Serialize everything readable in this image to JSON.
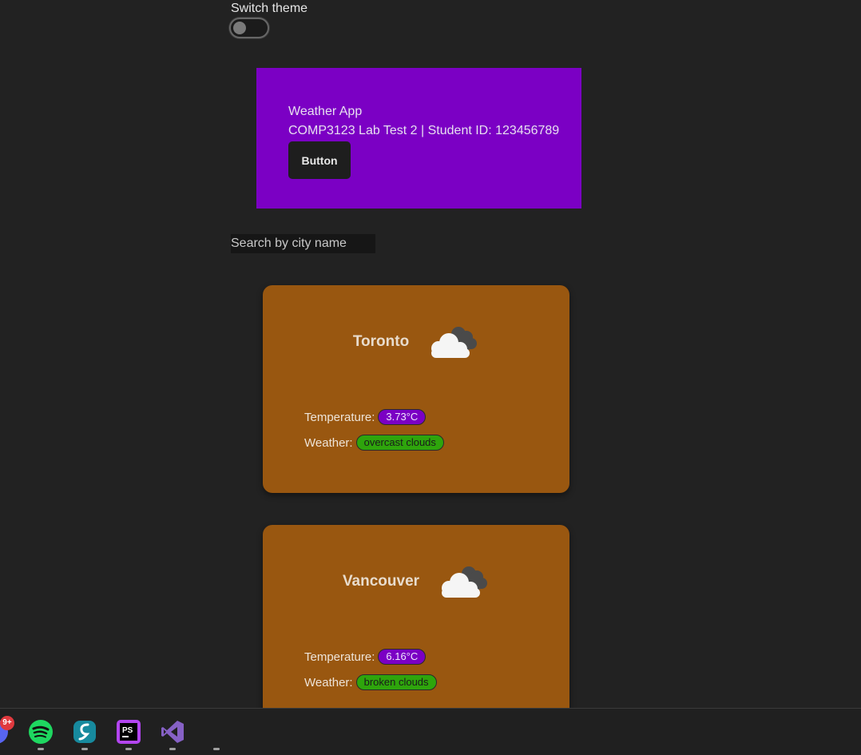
{
  "theme": {
    "label": "Switch theme",
    "enabled": false
  },
  "header": {
    "title": "Weather App",
    "subtitle": "COMP3123 Lab Test 2 | Student ID: 123456789",
    "button_label": "Button"
  },
  "search": {
    "placeholder": "Search by city name",
    "value": ""
  },
  "cards": [
    {
      "city": "Toronto",
      "icon": "cloud-icon",
      "temperature_label": "Temperature:",
      "temperature": "3.73°C",
      "weather_label": "Weather:",
      "weather": "overcast clouds"
    },
    {
      "city": "Vancouver",
      "icon": "cloud-icon",
      "temperature_label": "Temperature:",
      "temperature": "6.16°C",
      "weather_label": "Weather:",
      "weather": "broken clouds"
    }
  ],
  "taskbar": {
    "notification_badge": "9+",
    "apps": [
      "discord-icon",
      "spotify-icon",
      "surfshark-icon",
      "phpstorm-icon",
      "visual-studio-icon"
    ]
  },
  "colors": {
    "background": "#222222",
    "header": "#7b00c4",
    "card": "#995710",
    "temperature_pill": "#7b00c4",
    "weather_pill": "#2ea50c"
  }
}
